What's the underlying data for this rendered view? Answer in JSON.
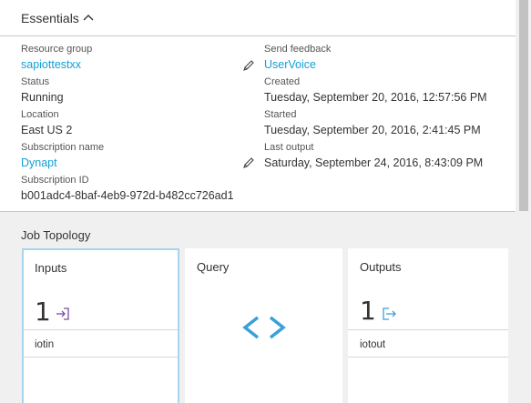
{
  "essentials": {
    "title": "Essentials",
    "left": [
      {
        "label": "Resource group",
        "value": "sapiottestxx",
        "link": true
      },
      {
        "label": "Status",
        "value": "Running",
        "link": false
      },
      {
        "label": "Location",
        "value": "East US 2",
        "link": false
      },
      {
        "label": "Subscription name",
        "value": "Dynapt",
        "link": true
      },
      {
        "label": "Subscription ID",
        "value": "b001adc4-8baf-4eb9-972d-b482cc726ad1",
        "link": false
      }
    ],
    "right": [
      {
        "label": "Send feedback",
        "value": "UserVoice",
        "link": true
      },
      {
        "label": "Created",
        "value": "Tuesday, September 20, 2016, 12:57:56 PM",
        "link": false
      },
      {
        "label": "Started",
        "value": "Tuesday, September 20, 2016, 2:41:45 PM",
        "link": false
      },
      {
        "label": "Last output",
        "value": "Saturday, September 24, 2016, 8:43:09 PM",
        "link": false
      }
    ]
  },
  "topology": {
    "title": "Job Topology",
    "inputs": {
      "title": "Inputs",
      "count": "1",
      "items": [
        "iotin"
      ]
    },
    "query": {
      "title": "Query",
      "symbol": "< >"
    },
    "outputs": {
      "title": "Outputs",
      "count": "1",
      "items": [
        "iotout"
      ]
    }
  },
  "colors": {
    "link": "#12a0d6",
    "accent_border": "#a8d4ec",
    "input_icon": "#7a4ea3",
    "output_icon": "#3aa0d8"
  }
}
